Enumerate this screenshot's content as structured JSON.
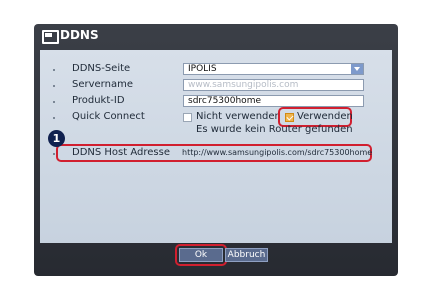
{
  "window": {
    "title": "DDNS"
  },
  "form": {
    "ddns_site": {
      "label": "DDNS-Seite",
      "value": "IPOLIS"
    },
    "servername": {
      "label": "Servername",
      "value": "www.samsungipolis.com"
    },
    "product_id": {
      "label": "Produkt-ID",
      "value": "sdrc75300home"
    },
    "quick_connect": {
      "label": "Quick Connect",
      "option_off": "Nicht verwenden",
      "option_on": "Verwenden",
      "selected": "Verwenden",
      "hint": "Es wurde kein Router gefunden"
    },
    "host_address": {
      "label": "DDNS Host Adresse",
      "value": "http://www.samsungipolis.com/sdrc75300home"
    }
  },
  "callout": {
    "number": "1"
  },
  "buttons": {
    "ok": "Ok",
    "cancel": "Abbruch"
  },
  "colors": {
    "highlight": "#d11f2f",
    "panel": "#cfd8e3",
    "window": "#2e323a"
  }
}
